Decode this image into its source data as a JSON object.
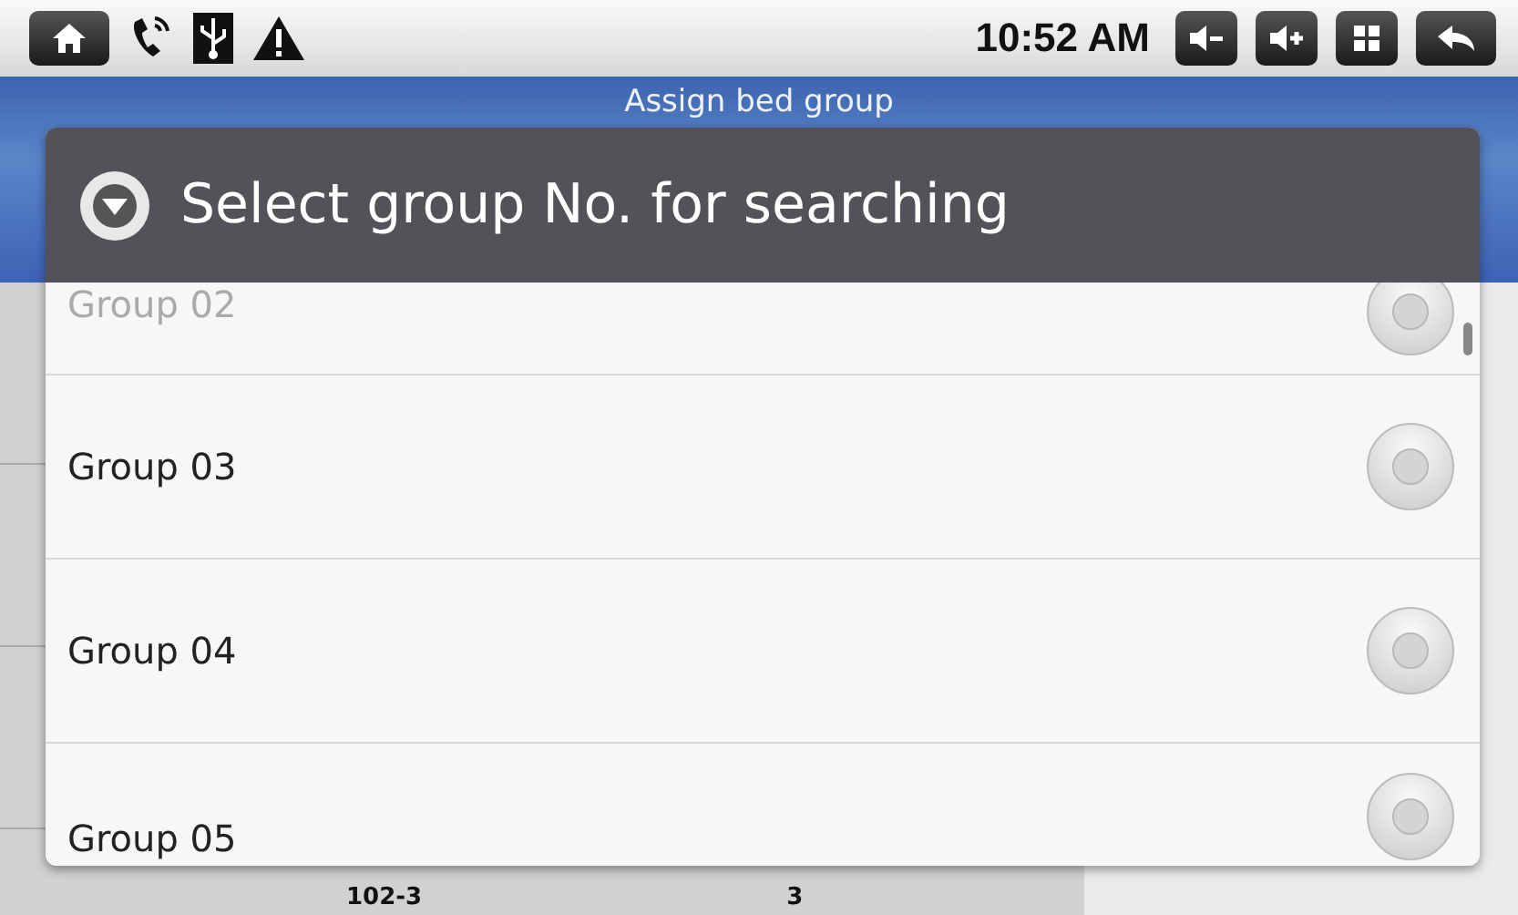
{
  "status_bar": {
    "time": "10:52 AM"
  },
  "screen": {
    "title": "Assign bed group",
    "rows": [
      {
        "bed": "102-3",
        "count": "3"
      }
    ]
  },
  "dialog": {
    "title": "Select group No. for searching",
    "options": [
      {
        "label": "Group 02",
        "selected": false
      },
      {
        "label": "Group 03",
        "selected": false
      },
      {
        "label": "Group 04",
        "selected": false
      },
      {
        "label": "Group 05",
        "selected": false
      }
    ]
  }
}
